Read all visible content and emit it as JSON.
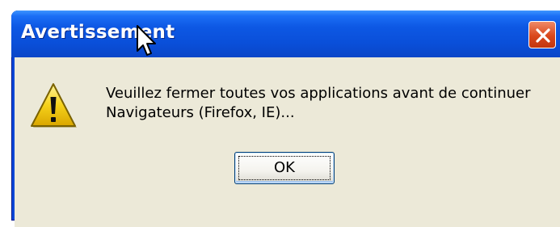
{
  "window": {
    "title": "Avertissement",
    "close_icon": "close-x-icon"
  },
  "dialog": {
    "icon": "warning-exclamation-icon",
    "message_line1": "Veuillez fermer toutes vos applications avant de continuer",
    "message_line2": "Navigateurs (Firefox, IE)...",
    "ok_label": "OK"
  },
  "cursor": {
    "icon": "arrow-cursor-icon"
  },
  "colors": {
    "titlebar": "#0a4fd9",
    "client_background": "#ece9d8",
    "close_button": "#d9471c",
    "warning_yellow": "#f6d21b"
  }
}
